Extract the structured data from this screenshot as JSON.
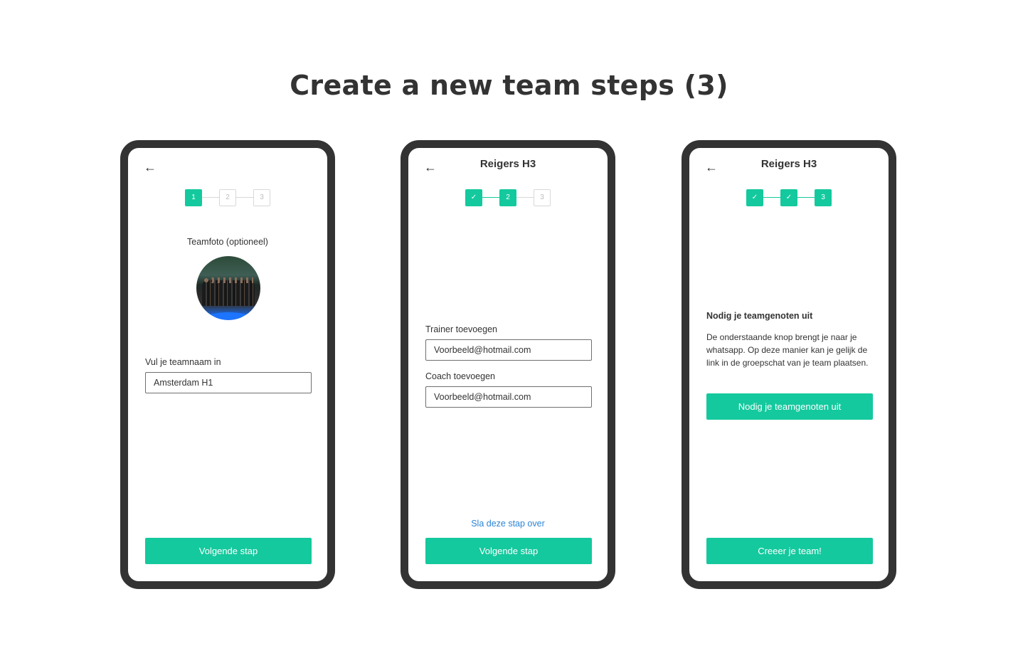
{
  "page": {
    "title": "Create a new team steps (3)"
  },
  "colors": {
    "accent": "#14c99e",
    "frame": "#333333",
    "link": "#2b84d6"
  },
  "screen1": {
    "back_icon": "←",
    "steps": [
      "1",
      "2",
      "3"
    ],
    "photo_label": "Teamfoto (optioneel)",
    "name_label": "Vul je teamnaam in",
    "name_value": "Amsterdam H1",
    "next_button": "Volgende stap"
  },
  "screen2": {
    "back_icon": "←",
    "title": "Reigers H3",
    "steps": [
      "✓",
      "2",
      "3"
    ],
    "trainer_label": "Trainer toevoegen",
    "trainer_value": "Voorbeeld@hotmail.com",
    "coach_label": "Coach toevoegen",
    "coach_value": "Voorbeeld@hotmail.com",
    "skip_link": "Sla deze stap over",
    "next_button": "Volgende stap"
  },
  "screen3": {
    "back_icon": "←",
    "title": "Reigers H3",
    "steps": [
      "✓",
      "✓",
      "3"
    ],
    "invite_heading": "Nodig je teamgenoten uit",
    "invite_text": "De onderstaande knop brengt je naar je whatsapp. Op deze manier kan je gelijk de link in de groepschat van je team plaatsen.",
    "invite_button": "Nodig je teamgenoten uit",
    "create_button": "Creeer je team!"
  }
}
